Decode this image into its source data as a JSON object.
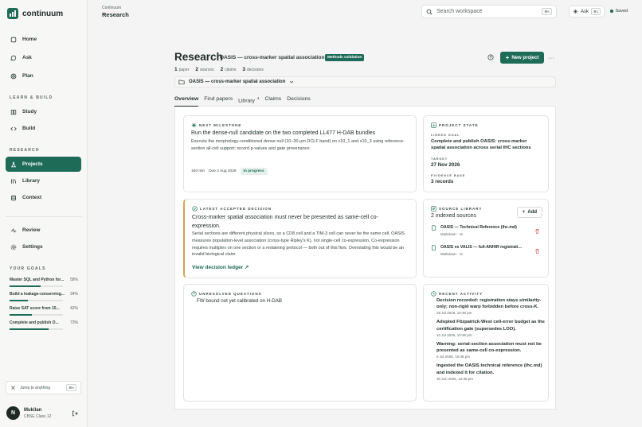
{
  "app": {
    "name": "continuum"
  },
  "sidebar": {
    "nav_main": [
      {
        "label": "Home",
        "icon": "home-icon"
      },
      {
        "label": "Ask",
        "icon": "chat-icon"
      },
      {
        "label": "Plan",
        "icon": "target-icon"
      }
    ],
    "learn_title": "LEARN & BUILD",
    "nav_learn": [
      {
        "label": "Study",
        "icon": "book-icon"
      },
      {
        "label": "Build",
        "icon": "code-icon"
      }
    ],
    "research_title": "RESEARCH",
    "nav_research": [
      {
        "label": "Projects",
        "icon": "flask-icon",
        "active": true
      },
      {
        "label": "Library",
        "icon": "library-icon"
      },
      {
        "label": "Context",
        "icon": "database-icon"
      }
    ],
    "nav_bottom": [
      {
        "label": "Review",
        "icon": "activity-icon"
      },
      {
        "label": "Settings",
        "icon": "gear-icon"
      }
    ],
    "goals_title": "YOUR GOALS",
    "goals": [
      {
        "label": "Master SQL and Python for...",
        "pct": "58%",
        "progress": 0.58
      },
      {
        "label": "Build a leakage-conserving...",
        "pct": "34%",
        "progress": 0.34
      },
      {
        "label": "Raise SAT score from 15...",
        "pct": "42%",
        "progress": 0.42
      },
      {
        "label": "Complete and publish O...",
        "pct": "73%",
        "progress": 0.73
      }
    ],
    "jump_label": "Jump to anything",
    "jump_kbd": "⌘K",
    "user": {
      "initial": "N",
      "name": "Mukilan",
      "subtitle": "CBSE Class 12"
    }
  },
  "topbar": {
    "crumb_parent": "Continuum",
    "crumb_current": "Research",
    "search_placeholder": "Search workspace",
    "search_kbd": "⌘K",
    "ask_label": "Ask",
    "ask_kbd": "⌘J",
    "saved_label": "Saved"
  },
  "header": {
    "title": "Research",
    "project_name": "OASIS — cross-marker spatial association",
    "badge": "Methods validation",
    "new_project_label": "New project",
    "more_label": "···",
    "stats": [
      {
        "value": "1",
        "label": "paper"
      },
      {
        "value": "2",
        "label": "sources"
      },
      {
        "value": "2",
        "label": "claims"
      },
      {
        "value": "3",
        "label": "decisions"
      }
    ],
    "selector_label": "OASIS — cross-marker spatial association"
  },
  "tabs": [
    {
      "label": "Overview",
      "active": true,
      "count": ""
    },
    {
      "label": "Find papers",
      "active": false,
      "count": ""
    },
    {
      "label": "Library",
      "active": false,
      "count": "4"
    },
    {
      "label": "Claims",
      "active": false,
      "count": ""
    },
    {
      "label": "Decisions",
      "active": false,
      "count": ""
    }
  ],
  "next_milestone": {
    "label": "NEXT MILESTONE",
    "title": "Run the dense-null candidate on the two completed LL477 H-DAB bundles",
    "body": "Execute the morphology-conditioned dense null (10–30 μm DCLF band) on x10_1 and x10_3 using reference-section all-cell support; record p-values and gate provenance.",
    "duration": "150 min",
    "due": "Due 2 Aug 2026",
    "status": "In progress"
  },
  "project_state": {
    "label": "PROJECT STATE",
    "linked_goal_label": "LINKED GOAL",
    "linked_goal": "Complete and publish OASIS: cross-marker spatial association across serial IHC sections",
    "target_label": "TARGET",
    "target": "27 Nov 2026",
    "evidence_label": "EVIDENCE BASE",
    "evidence": "3 records"
  },
  "decision": {
    "label": "LATEST ACCEPTED DECISION",
    "title": "Cross-marker spatial association must never be presented as same-cell co-expression.",
    "body": "Serial sections are different physical slices, so a CD8 cell and a TIM-3 cell can never be the same cell. OASIS measures population-level association (cross-type Ripley's K), not single-cell co-expression. Co-expression requires multiplex on one section or a restaining protocol — both out of this flow. Overstating this would be an invalid biological claim.",
    "link": "View decision ledger ↗"
  },
  "library": {
    "label": "SOURCE LIBRARY",
    "count": "2 indexed sources",
    "add_label": "Add",
    "items": [
      {
        "title": "OASIS — Technical Reference (ihc.md)",
        "meta": "Markdown · v1"
      },
      {
        "title": "OASIS vs VALIS — full-ANHIR registration...",
        "meta": "Markdown · v1"
      }
    ]
  },
  "questions": {
    "label": "UNRESOLVED QUESTIONS",
    "items": [
      "FW bound not yet calibrated on H-DAB"
    ]
  },
  "activity": {
    "label": "RECENT ACTIVITY",
    "items": [
      {
        "text": "Decision recorded: registration stays similarity-only; non-rigid warp forbidden before cross-K.",
        "date": "28 Jul 2026, 10:36 pm"
      },
      {
        "text": "Adopted Fitzpatrick-West cell-error budget as the certification gate (supersedes LOO).",
        "date": "10 Jul 2026, 10:36 pm"
      },
      {
        "text": "Warning: serial-section association must not be presented as same-cell co-expression.",
        "date": "5 Jul 2026, 10:36 pm"
      },
      {
        "text": "Ingested the OASIS technical reference (ihc.md) and indexed it for citation.",
        "date": "30 Jun 2026, 10:36 pm"
      }
    ]
  },
  "colors": {
    "accent": "#1e6b57",
    "danger": "#d64545",
    "background": "#f3f4f3"
  }
}
